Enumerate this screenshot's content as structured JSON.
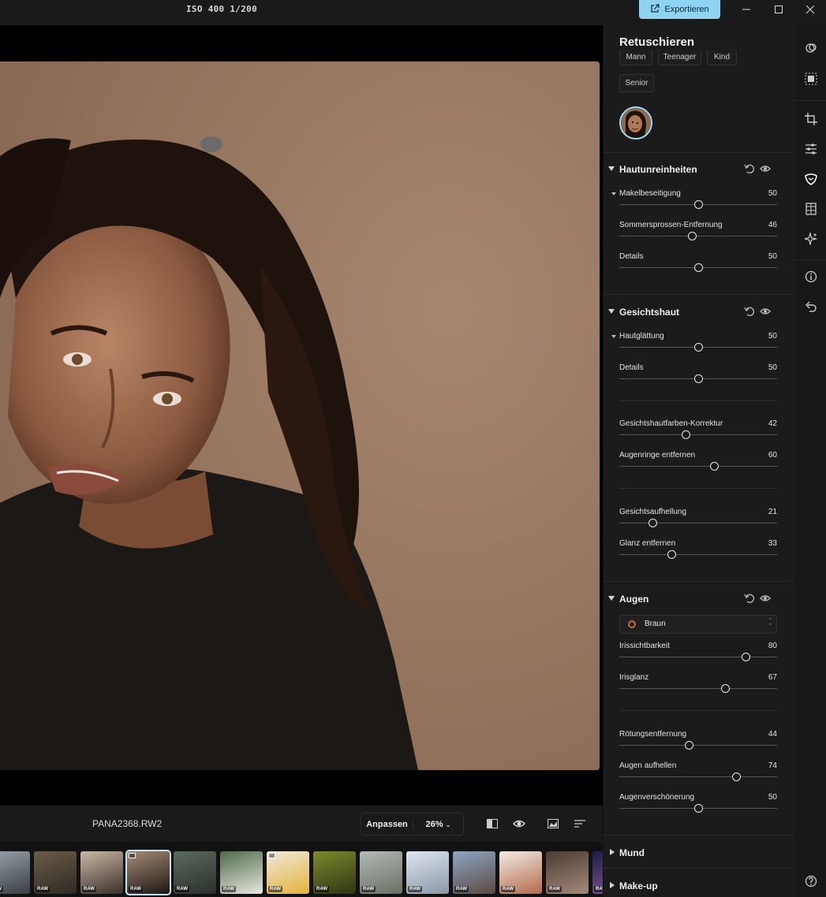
{
  "topbar": {
    "exif": "ISO 400  1/200",
    "export_label": "Exportieren",
    "window_controls": [
      "minimize-icon",
      "maximize-icon",
      "close-icon"
    ]
  },
  "canvas": {
    "photo_description_icon": "portrait-photo"
  },
  "infobar": {
    "filename": "PANA2368.RW2",
    "fit_label": "Anpassen",
    "zoom": "26%",
    "icons": [
      "compare-icon",
      "eye-icon",
      "histogram-icon",
      "sort-icon"
    ]
  },
  "filmstrip": {
    "badge": "RAW",
    "thumbs": [
      {
        "colors": [
          "#9aa4ad",
          "#3b3e44"
        ],
        "raw": true,
        "stack": false,
        "selected": false
      },
      {
        "colors": [
          "#6b5c48",
          "#2e2a24"
        ],
        "raw": true,
        "stack": false,
        "selected": false
      },
      {
        "colors": [
          "#c9b8a6",
          "#3a2f2a"
        ],
        "raw": true,
        "stack": false,
        "selected": false
      },
      {
        "colors": [
          "#a78b76",
          "#1c1714"
        ],
        "raw": true,
        "stack": true,
        "selected": true
      },
      {
        "colors": [
          "#5c6a5e",
          "#2b302c"
        ],
        "raw": true,
        "stack": false,
        "selected": false
      },
      {
        "colors": [
          "#4f6b4a",
          "#e8e6e0"
        ],
        "raw": true,
        "stack": false,
        "selected": false
      },
      {
        "colors": [
          "#f0e8dd",
          "#e3b33a"
        ],
        "raw": true,
        "stack": true,
        "selected": false
      },
      {
        "colors": [
          "#7e8a2e",
          "#2f3412"
        ],
        "raw": true,
        "stack": false,
        "selected": false
      },
      {
        "colors": [
          "#b3b9b6",
          "#6a6f63"
        ],
        "raw": true,
        "stack": false,
        "selected": false
      },
      {
        "colors": [
          "#dfe6ee",
          "#8a97a8"
        ],
        "raw": true,
        "stack": false,
        "selected": false
      },
      {
        "colors": [
          "#8fa6c4",
          "#5a4a42"
        ],
        "raw": true,
        "stack": false,
        "selected": false
      },
      {
        "colors": [
          "#f2ebe4",
          "#b46a4a"
        ],
        "raw": true,
        "stack": false,
        "selected": false
      },
      {
        "colors": [
          "#4a3b33",
          "#a58a7a"
        ],
        "raw": true,
        "stack": false,
        "selected": false
      },
      {
        "colors": [
          "#1c1c4a",
          "#8a5a9a"
        ],
        "raw": true,
        "stack": false,
        "selected": false
      }
    ]
  },
  "panel": {
    "title": "Retuschieren",
    "chips_row1": [
      "Mann",
      "Teenager",
      "Kind"
    ],
    "chip_senior": "Senior",
    "sections": {
      "hautunreinheiten": {
        "title": "Hautunreinheiten",
        "sliders": [
          {
            "label": "Makelbeseitigung",
            "value": 50,
            "sub": true
          },
          {
            "label": "Sommersprossen-Entfernung",
            "value": 46,
            "sub": false
          },
          {
            "label": "Details",
            "value": 50,
            "sub": false
          }
        ]
      },
      "gesichtshaut": {
        "title": "Gesichtshaut",
        "sliders": [
          {
            "label": "Hautglättung",
            "value": 50,
            "sub": true
          },
          {
            "label": "Details",
            "value": 50,
            "sub": false
          },
          {
            "label": "Gesichtshautfarben-Korrektur",
            "value": 42,
            "sub": false
          },
          {
            "label": "Augenringe entfernen",
            "value": 60,
            "sub": false
          },
          {
            "label": "Gesichtsaufhellung",
            "value": 21,
            "sub": false
          },
          {
            "label": "Glanz entfernen",
            "value": 33,
            "sub": false
          }
        ]
      },
      "augen": {
        "title": "Augen",
        "eye_color": "Braun",
        "sliders": [
          {
            "label": "Irissichtbarkeit",
            "value": 80,
            "sub": false
          },
          {
            "label": "Irisglanz",
            "value": 67,
            "sub": false
          },
          {
            "label": "Rötungsentfernung",
            "value": 44,
            "sub": false
          },
          {
            "label": "Augen aufhellen",
            "value": 74,
            "sub": false
          },
          {
            "label": "Augenverschönerung",
            "value": 50,
            "sub": false
          }
        ]
      },
      "mund": {
        "title": "Mund"
      },
      "makeup": {
        "title": "Make-up"
      }
    }
  },
  "rail": {
    "tools": [
      "layers-icon",
      "mask-icon",
      "crop-icon",
      "adjust-sliders-icon",
      "retouch-face-icon",
      "geometry-icon",
      "ai-sparkle-icon",
      "info-icon",
      "undo-history-icon"
    ],
    "help": "help-icon"
  },
  "colors": {
    "accent": "#8fd3f2",
    "panel_bg": "#1b1b1b",
    "photo_bg": "#a07e66"
  }
}
